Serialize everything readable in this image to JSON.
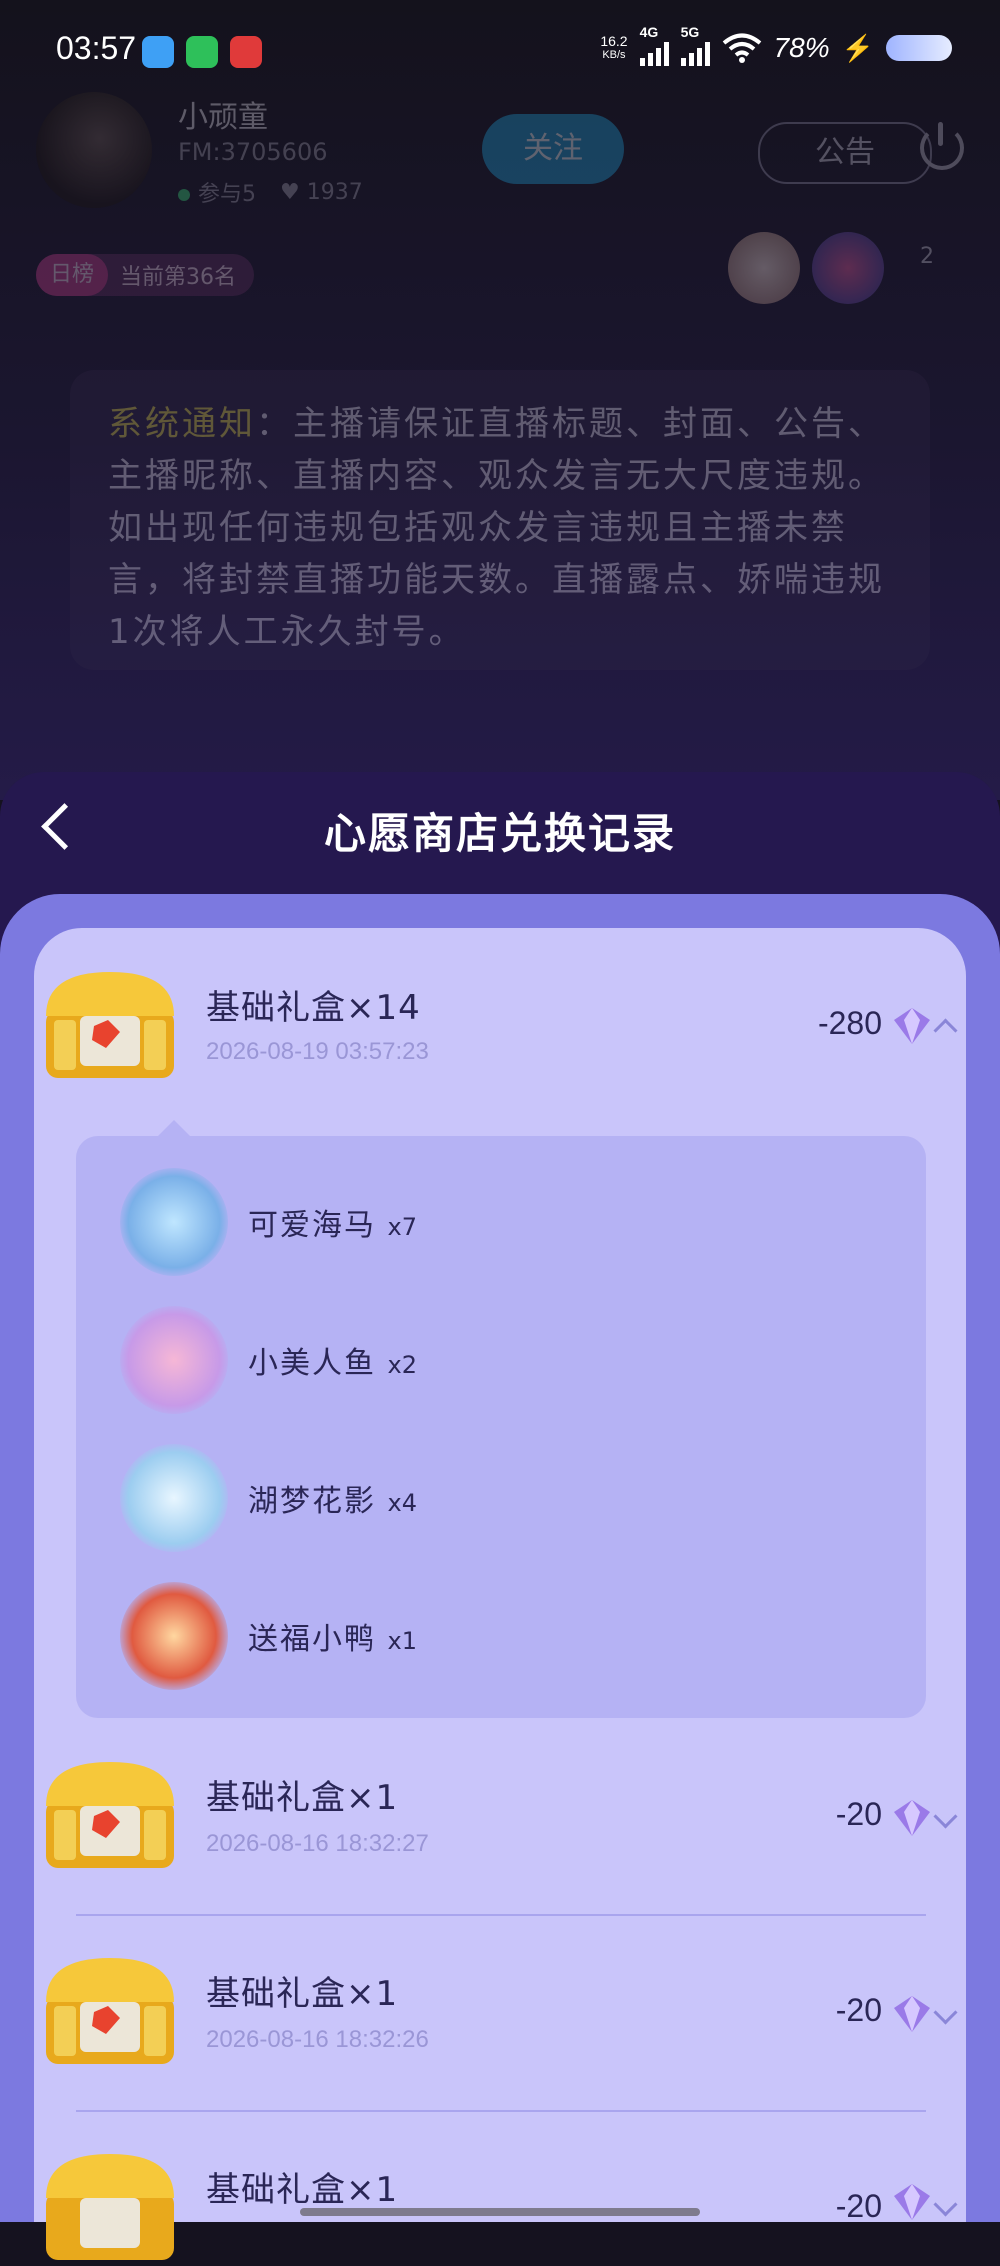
{
  "status_bar": {
    "time": "03:57",
    "net_speed_value": "16.2",
    "net_speed_unit": "KB/s",
    "signal_1_label": "4G",
    "signal_2_label": "5G",
    "battery_percent": "78%"
  },
  "live_room": {
    "host_name": "小顽童",
    "host_id": "FM:3705606",
    "participants_label": "参与5",
    "likes_count": "1937",
    "follow_label": "关注",
    "notice_label": "公告",
    "rank_tag": "日榜",
    "rank_text": "当前第36名",
    "viewer_count": "2",
    "system_notice_label": "系统通知",
    "system_notice_text": "：主播请保证直播标题、封面、公告、主播昵称、直播内容、观众发言无大尺度违规。如出现任何违规包括观众发言违规且主播未禁言，将封禁直播功能天数。直播露点、娇喘违规1次将人工永久封号。"
  },
  "sheet": {
    "title": "心愿商店兑换记录"
  },
  "records": [
    {
      "title": "基础礼盒×14",
      "time": "2026-08-19 03:57:23",
      "amount": "-280",
      "expanded": true,
      "items": [
        {
          "name": "可爱海马",
          "qty": "x7"
        },
        {
          "name": "小美人鱼",
          "qty": "x2"
        },
        {
          "name": "湖梦花影",
          "qty": "x4"
        },
        {
          "name": "送福小鸭",
          "qty": "x1"
        }
      ]
    },
    {
      "title": "基础礼盒×1",
      "time": "2026-08-16 18:32:27",
      "amount": "-20",
      "expanded": false
    },
    {
      "title": "基础礼盒×1",
      "time": "2026-08-16 18:32:26",
      "amount": "-20",
      "expanded": false
    },
    {
      "title": "基础礼盒×1",
      "time": "",
      "amount": "-20",
      "expanded": false
    }
  ]
}
